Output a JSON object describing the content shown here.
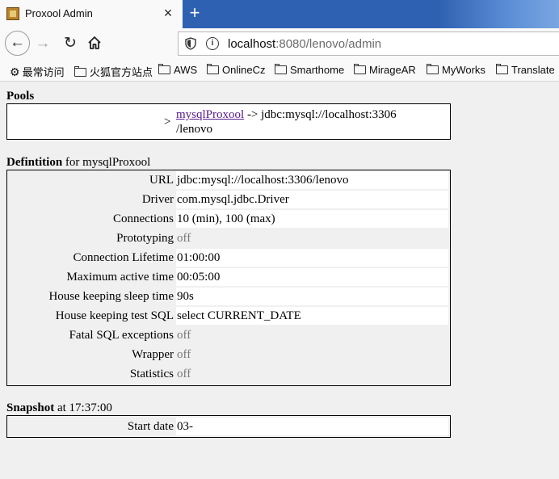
{
  "browser": {
    "tab_title": "Proxool Admin",
    "tab_close": "×",
    "new_tab": "+",
    "url_host": "localhost",
    "url_rest": ":8080/lenovo/admin"
  },
  "bookmarks": [
    {
      "label": "最常访问",
      "icon": "gear-icon"
    },
    {
      "label": "火狐官方站点",
      "icon": "folder-icon"
    },
    {
      "label": "AWS",
      "icon": "folder-icon"
    },
    {
      "label": "OnlineCz",
      "icon": "folder-icon"
    },
    {
      "label": "Smarthome",
      "icon": "folder-icon"
    },
    {
      "label": "MirageAR",
      "icon": "folder-icon"
    },
    {
      "label": "MyWorks",
      "icon": "folder-icon"
    },
    {
      "label": "Translate",
      "icon": "folder-icon"
    }
  ],
  "pools": {
    "title": "Pools",
    "arrow": ">",
    "link": "mysqlProxool",
    "line1": " -> jdbc:mysql://localhost:3306",
    "line2": "/lenovo"
  },
  "definition": {
    "title": "Defintition",
    "subtitle": " for mysqlProxool",
    "rows": [
      {
        "label": "URL",
        "value": "jdbc:mysql://localhost:3306/lenovo"
      },
      {
        "label": "Driver",
        "value": "com.mysql.jdbc.Driver"
      },
      {
        "label": "Connections",
        "value": "10 (min), 100 (max)"
      },
      {
        "label": "Prototyping",
        "value": "off"
      },
      {
        "label": "Connection Lifetime",
        "value": "01:00:00"
      },
      {
        "label": "Maximum active time",
        "value": "00:05:00"
      },
      {
        "label": "House keeping sleep time",
        "value": "90s"
      },
      {
        "label": "House keeping test SQL",
        "value": "select CURRENT_DATE"
      },
      {
        "label": "Fatal SQL exceptions",
        "value": "off"
      },
      {
        "label": "Wrapper",
        "value": "off"
      },
      {
        "label": "Statistics",
        "value": "off"
      }
    ]
  },
  "snapshot": {
    "title": "Snapshot",
    "subtitle": " at 17:37:00",
    "rows": [
      {
        "label": "Start date",
        "value": "03-"
      }
    ]
  }
}
